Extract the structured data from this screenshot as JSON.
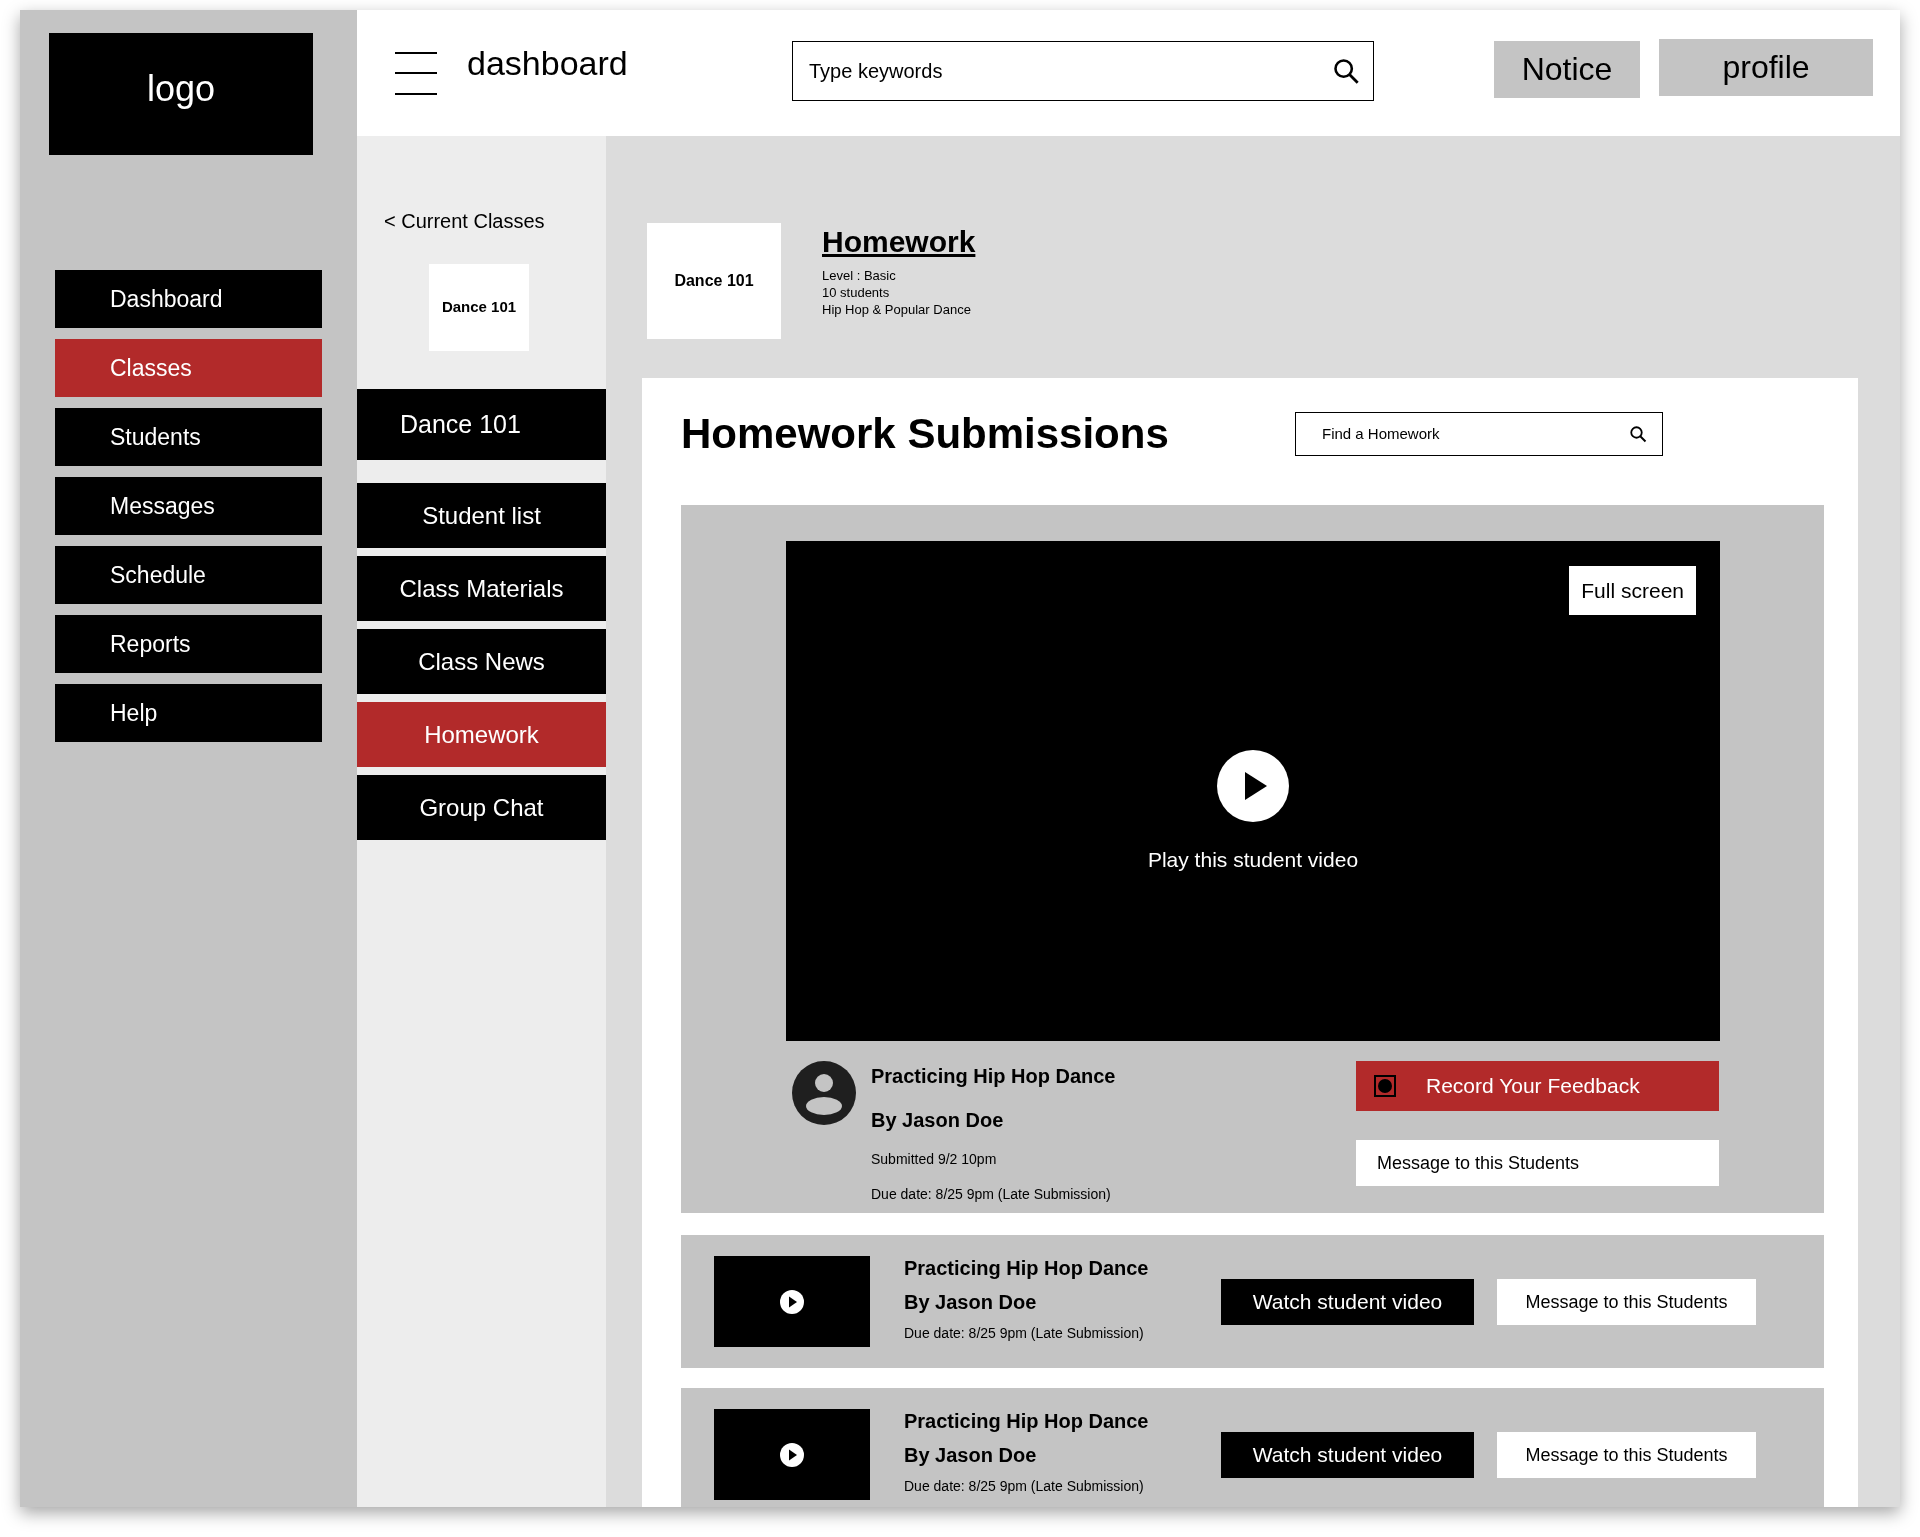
{
  "logo": "logo",
  "nav": [
    {
      "label": "Dashboard",
      "selected": false
    },
    {
      "label": "Classes",
      "selected": true
    },
    {
      "label": "Students",
      "selected": false
    },
    {
      "label": "Messages",
      "selected": false
    },
    {
      "label": "Schedule",
      "selected": false
    },
    {
      "label": "Reports",
      "selected": false
    },
    {
      "label": "Help",
      "selected": false
    }
  ],
  "header": {
    "title": "dashboard",
    "search": {
      "placeholder": "Type keywords"
    },
    "buttons": [
      "Notice",
      "profile"
    ]
  },
  "class_nav": {
    "back": "< Current Classes",
    "class_card": "Dance 101",
    "current": "Dance 101",
    "items": [
      {
        "label": "Student list",
        "selected": false
      },
      {
        "label": "Class Materials",
        "selected": false
      },
      {
        "label": "Class News",
        "selected": false
      },
      {
        "label": "Homework",
        "selected": true
      },
      {
        "label": "Group Chat",
        "selected": false
      }
    ]
  },
  "class_info": {
    "card": "Dance 101",
    "title": "Homework",
    "details": [
      "Level : Basic",
      "10 students",
      "Hip Hop  & Popular Dance"
    ]
  },
  "submissions": {
    "title": "Homework Submissions",
    "search": {
      "placeholder": "Find a Homework"
    },
    "featured": {
      "full_screen": "Full screen",
      "caption": "Play this student video",
      "title": "Practicing Hip Hop Dance",
      "author": "By Jason Doe",
      "submitted": "Submitted 9/2 10pm",
      "due": "Due date:  8/25 9pm  (Late Submission)",
      "record": "Record Your Feedback",
      "message": "Message to this Students"
    },
    "rows": [
      {
        "title": "Practicing Hip Hop Dance",
        "author": "By Jason Doe",
        "due": "Due date:  8/25 9pm  (Late Submission)",
        "watch": "Watch student video",
        "message": "Message to this Students"
      },
      {
        "title": "Practicing Hip Hop Dance",
        "author": "By Jason Doe",
        "due": "Due date:  8/25 9pm  (Late Submission)",
        "watch": "Watch student video",
        "message": "Message to this Students"
      }
    ]
  }
}
